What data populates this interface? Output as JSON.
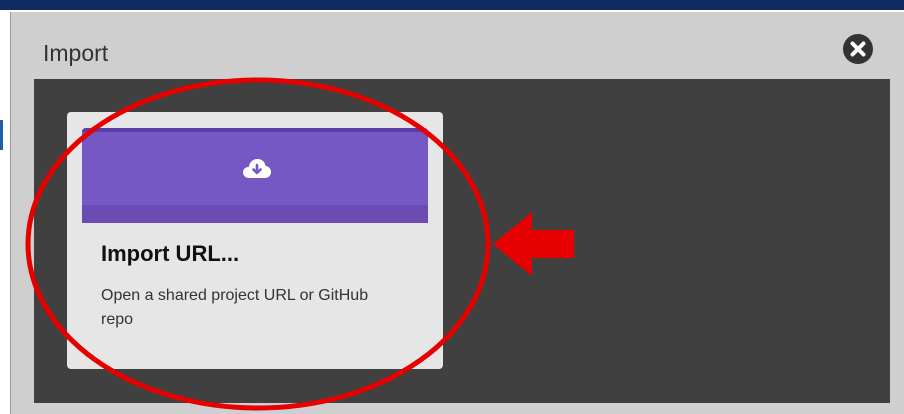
{
  "dialog": {
    "title": "Import",
    "close_icon": "close-circle-icon"
  },
  "cards": [
    {
      "title": "Import URL...",
      "description": "Open a shared project URL or GitHub repo",
      "icon": "cloud-download-icon",
      "banner_color": "#7658c4"
    }
  ],
  "annotation": {
    "color": "#e60000",
    "ellipse": "red-ellipse-highlight",
    "arrow": "red-arrow-left"
  }
}
